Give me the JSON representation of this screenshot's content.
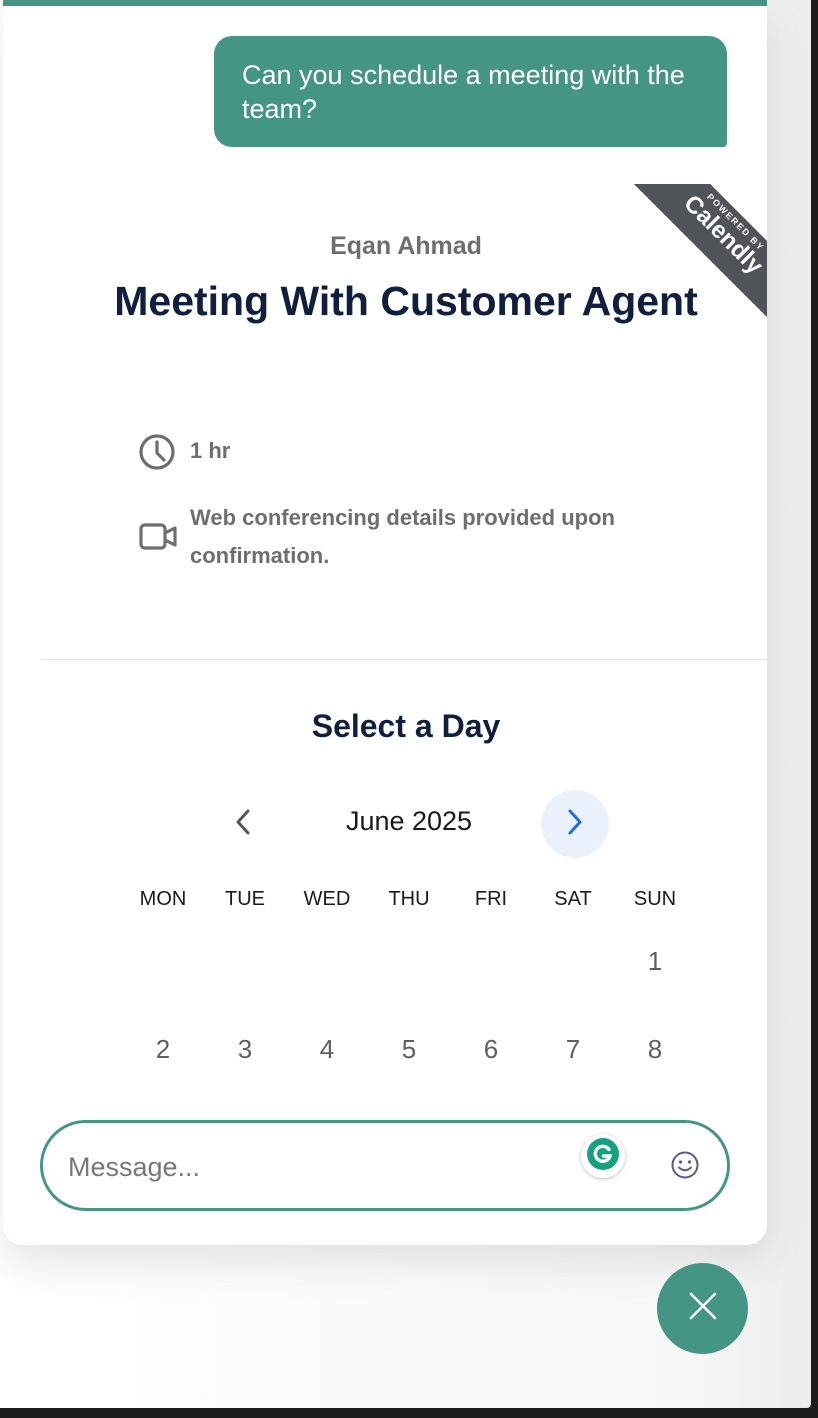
{
  "colors": {
    "accent": "#459584",
    "title": "#0f1f3d",
    "muted": "#6e6e6e",
    "nav_highlight": "#ebf1fc",
    "nav_arrow": "#1f6fe0",
    "ribbon": "#4f5459"
  },
  "chat": {
    "user_message": "Can you schedule a meeting with the team?"
  },
  "calendly": {
    "ribbon_powered_by": "POWERED BY",
    "ribbon_brand": "Calendly",
    "host_name": "Eqan Ahmad",
    "event_title": "Meeting With Customer Agent",
    "duration": "1 hr",
    "location": "Web conferencing details provided upon confirmation.",
    "select_day_title": "Select a Day",
    "month": "June 2025",
    "weekdays": [
      "MON",
      "TUE",
      "WED",
      "THU",
      "FRI",
      "SAT",
      "SUN"
    ],
    "weeks": [
      [
        "",
        "",
        "",
        "",
        "",
        "",
        "1"
      ],
      [
        "2",
        "3",
        "4",
        "5",
        "6",
        "7",
        "8"
      ]
    ],
    "icons": {
      "duration": "clock-icon",
      "location": "video-camera-icon",
      "prev": "chevron-left-icon",
      "next": "chevron-right-icon"
    }
  },
  "composer": {
    "placeholder": "Message...",
    "icons": {
      "grammarly": "grammarly-icon",
      "emoji": "emoji-icon"
    }
  },
  "launcher": {
    "icon": "close-icon"
  }
}
